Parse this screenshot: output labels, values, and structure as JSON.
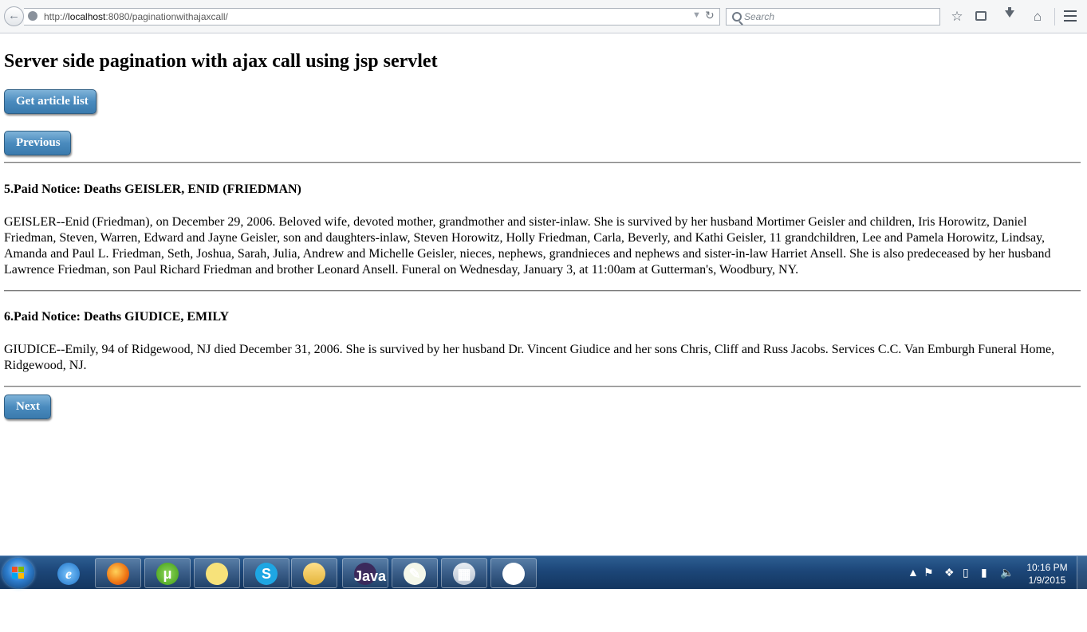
{
  "browser": {
    "url_prefix": "http://",
    "url_host": "localhost",
    "url_rest": ":8080/paginationwithajaxcall/",
    "search_placeholder": "Search",
    "icons": [
      "back-arrow-icon",
      "globe-icon",
      "dropmarker-icon",
      "reload-icon",
      "search-icon",
      "bookmark-star-icon",
      "reader-view-icon",
      "download-icon",
      "home-icon",
      "hamburger-menu-icon"
    ]
  },
  "page": {
    "title": "Server side pagination with ajax call using jsp servlet",
    "get_articles_label": "Get article list",
    "previous_label": "Previous",
    "next_label": "Next",
    "button_color": "#4a8bbe",
    "articles": [
      {
        "title": "5.Paid Notice: Deaths GEISLER, ENID (FRIEDMAN)",
        "body": "GEISLER--Enid (Friedman), on December 29, 2006. Beloved wife, devoted mother, grandmother and sister-inlaw. She is survived by her husband Mortimer Geisler and children, Iris Horowitz, Daniel Friedman, Steven, Warren, Edward and Jayne Geisler, son and daughters-inlaw, Steven Horowitz, Holly Friedman, Carla, Beverly, and Kathi Geisler, 11 grandchildren, Lee and Pamela Horowitz, Lindsay, Amanda and Paul L. Friedman, Seth, Joshua, Sarah, Julia, Andrew and Michelle Geisler, nieces, nephews, grandnieces and nephews and sister-in-law Harriet Ansell. She is also predeceased by her husband Lawrence Friedman, son Paul Richard Friedman and brother Leonard Ansell. Funeral on Wednesday, January 3, at 11:00am at Gutterman's, Woodbury, NY."
      },
      {
        "title": "6.Paid Notice: Deaths GIUDICE, EMILY",
        "body": "GIUDICE--Emily, 94 of Ridgewood, NJ died December 31, 2006. She is survived by her husband Dr. Vincent Giudice and her sons Chris, Cliff and Russ Jacobs. Services C.C. Van Emburgh Funeral Home, Ridgewood, NJ."
      }
    ]
  },
  "taskbar": {
    "apps": [
      "start-orb",
      "internet-explorer",
      "firefox",
      "utorrent",
      "sticky-notes",
      "skype",
      "file-explorer",
      "eclipse-java-ee-ide",
      "notepad-plus-plus",
      "calculator",
      "github-desktop"
    ],
    "eclipse_badge": "Java EE IDE",
    "clock_time": "10:16 PM",
    "clock_date": "1/9/2015"
  }
}
